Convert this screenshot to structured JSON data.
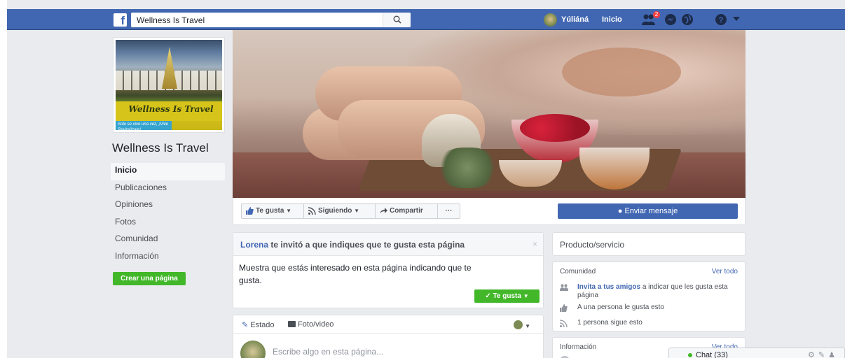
{
  "topbar": {
    "search_value": "Wellness Is Travel",
    "user_name": "Yúliáná",
    "home_label": "Inicio",
    "friend_requests_badge": "2"
  },
  "page": {
    "name": "Wellness Is Travel",
    "profile_logo_text": "Wellness Is Travel",
    "profile_tagline": "Solo se vive una vez, ¡Vive Revitalízate!"
  },
  "left_nav": {
    "items": [
      "Inicio",
      "Publicaciones",
      "Opiniones",
      "Fotos",
      "Comunidad",
      "Información"
    ],
    "active": "Inicio",
    "create_page": "Crear una página"
  },
  "actions": {
    "like": "Te gusta",
    "following": "Siguiendo",
    "share": "Compartir",
    "more": "···",
    "send_message": "Enviar mensaje"
  },
  "invite": {
    "inviter": "Lorena",
    "text": "te invitó a que indiques que te gusta esta página",
    "close": "×",
    "body": "Muestra que estás interesado en esta página indicando que te gusta.",
    "like_button": "Te gusta"
  },
  "composer": {
    "tab_status": "Estado",
    "tab_photo": "Foto/video",
    "placeholder": "Escribe algo en esta página..."
  },
  "sidebar": {
    "category": "Producto/servicio",
    "community_title": "Comunidad",
    "see_all": "Ver todo",
    "invite_link": "Invita a tus amigos",
    "invite_rest": "a indicar que les gusta esta página",
    "likes_text": "A una persona le gusta esto",
    "follows_text": "1 persona sigue esto",
    "info_title": "Información",
    "info_see_all": "Ver todo"
  },
  "chat": {
    "label": "Chat (33)"
  },
  "colors": {
    "brand_blue": "#4267b2",
    "green": "#42b72a",
    "background": "#e9ebee"
  }
}
